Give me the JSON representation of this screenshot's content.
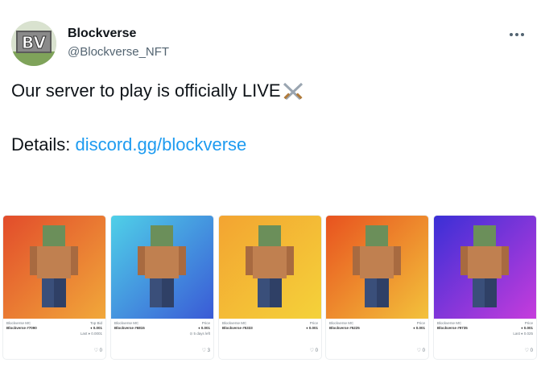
{
  "tweet": {
    "display_name": "Blockverse",
    "handle": "@Blockverse_NFT",
    "avatar_text": "BV",
    "more_icon": "more-icon",
    "line1_text": "Our server to play is officially LIVE",
    "emoji": "crossed-swords-icon",
    "line2_prefix": "Details: ",
    "line2_link": "discord.gg/blockverse"
  },
  "cards": [
    {
      "bg1": "#e24c2b",
      "bg2": "#f1a83a",
      "collection": "Blockverse MC",
      "token": "Blockverse #7090",
      "price_label": "Top Bid",
      "price": "♦ 0.001",
      "sub": "Last ♦ 0.0001",
      "favs": "♡ 0"
    },
    {
      "bg1": "#4fd0e8",
      "bg2": "#3a5ad6",
      "collection": "Blockverse MC",
      "token": "Blockverse #6815",
      "price_label": "Price",
      "price": "♦ 0.001",
      "sub": "⊙ 5 days left",
      "favs": "♡ 3"
    },
    {
      "bg1": "#f3a431",
      "bg2": "#f4d23a",
      "collection": "Blockverse MC",
      "token": "Blockverse #5333",
      "price_label": "Price",
      "price": "♦ 0.001",
      "sub": "",
      "favs": "♡ 0"
    },
    {
      "bg1": "#e8521f",
      "bg2": "#f3c23b",
      "collection": "Blockverse MC",
      "token": "Blockverse #5225",
      "price_label": "Price",
      "price": "♦ 0.001",
      "sub": "",
      "favs": "♡ 0"
    },
    {
      "bg1": "#3a2fd6",
      "bg2": "#c63cdc",
      "collection": "Blockverse MC",
      "token": "Blockverse #9735",
      "price_label": "Price",
      "price": "♦ 0.001",
      "sub": "Last ♦ 0.025",
      "favs": "♡ 0"
    }
  ]
}
